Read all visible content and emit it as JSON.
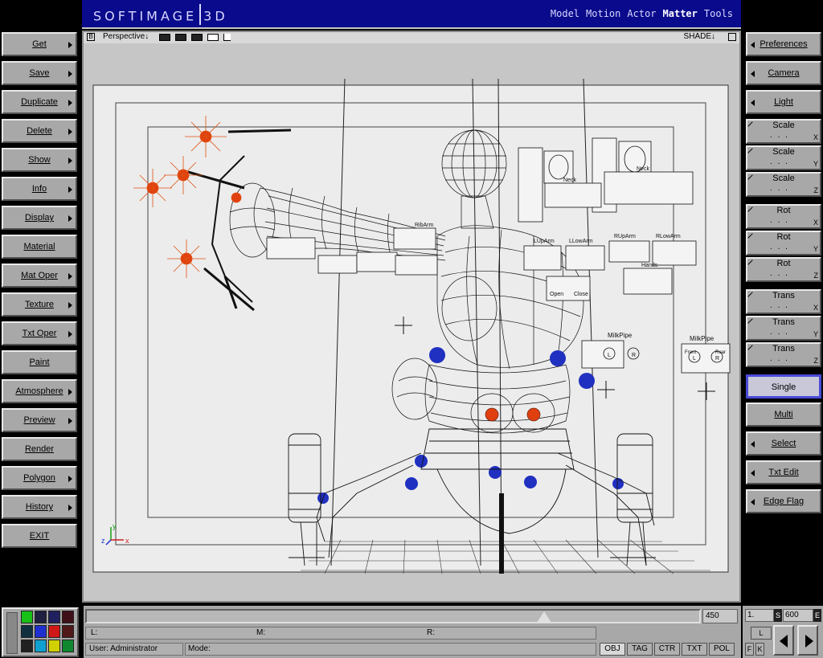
{
  "app": {
    "logo_left": "SOFTIMAGE",
    "logo_right": "3D"
  },
  "modules": [
    {
      "label": "Model",
      "active": false
    },
    {
      "label": "Motion",
      "active": false
    },
    {
      "label": "Actor",
      "active": false
    },
    {
      "label": "Matter",
      "active": true
    },
    {
      "label": "Tools",
      "active": false
    }
  ],
  "left_menu": [
    {
      "label": "Get",
      "arrow": true
    },
    {
      "label": "Save",
      "arrow": true
    },
    {
      "label": "Duplicate",
      "arrow": true
    },
    {
      "label": "Delete",
      "arrow": true
    },
    {
      "label": "Show",
      "arrow": true
    },
    {
      "label": "Info",
      "arrow": true
    },
    {
      "label": "Display",
      "arrow": true
    },
    {
      "label": "Material",
      "arrow": false
    },
    {
      "label": "Mat Oper",
      "arrow": true
    },
    {
      "label": "Texture",
      "arrow": true
    },
    {
      "label": "Txt Oper",
      "arrow": true
    },
    {
      "label": "Paint",
      "arrow": false
    },
    {
      "label": "Atmosphere",
      "arrow": true
    },
    {
      "label": "Preview",
      "arrow": true
    },
    {
      "label": "Render",
      "arrow": false
    },
    {
      "label": "Polygon",
      "arrow": true
    },
    {
      "label": "History",
      "arrow": true
    },
    {
      "label": "EXIT",
      "arrow": false
    }
  ],
  "right_menu": {
    "top": [
      {
        "label": "Preferences"
      },
      {
        "label": "Camera"
      },
      {
        "label": "Light"
      }
    ],
    "axis_groups": [
      {
        "label": "Scale",
        "dots": ". . .",
        "axes": [
          "X",
          "Y",
          "Z"
        ]
      },
      {
        "label": "Rot",
        "dots": ". . .",
        "axes": [
          "X",
          "Y",
          "Z"
        ]
      },
      {
        "label": "Trans",
        "dots": ". . .",
        "axes": [
          "X",
          "Y",
          "Z"
        ]
      }
    ],
    "single": "Single",
    "multi": "Multi",
    "bottom": [
      {
        "label": "Select"
      },
      {
        "label": "Txt Edit"
      },
      {
        "label": "Edge Flag"
      }
    ]
  },
  "viewport": {
    "badge": "B",
    "name": "Perspective",
    "shade": "SHADE",
    "axis_labels": {
      "x": "x",
      "y": "y",
      "z": "z"
    },
    "rig_labels": {
      "neck_left": "Neck",
      "neck_right": "Neck",
      "rib_arm": "RibArm",
      "lup_arm": "LUpArm",
      "llow_arm": "LLowArm",
      "rup_arm": "RUpArm",
      "rlow_arm": "RLowArm",
      "hands": "Hands",
      "milk_pipe_1": "MilkPipe",
      "milk_pipe_2": "MilkPipe",
      "open": "Open",
      "close": "Close",
      "l": "L",
      "r": "R",
      "front": "Front",
      "rear": "Rear"
    }
  },
  "palette": {
    "colors": [
      "#18c018",
      "#202040",
      "#202060",
      "#401018",
      "#103040",
      "#2030d0",
      "#d01818",
      "#501818",
      "#202020",
      "#10a0d0",
      "#d0d000",
      "#108830",
      "#202020"
    ]
  },
  "timeline": {
    "current_frame": "450",
    "start": "1.",
    "end": "600",
    "start_tag": "S",
    "end_tag": "E",
    "l_label": "L",
    "r_label": "R:",
    "m_label": "M:",
    "left_label": "L:",
    "user": "User:  Administrator",
    "mode": "Mode:",
    "mode_buttons": [
      "OBJ",
      "TAG",
      "CTR",
      "TXT",
      "POL"
    ],
    "f_label": "F",
    "k_label": "K"
  }
}
